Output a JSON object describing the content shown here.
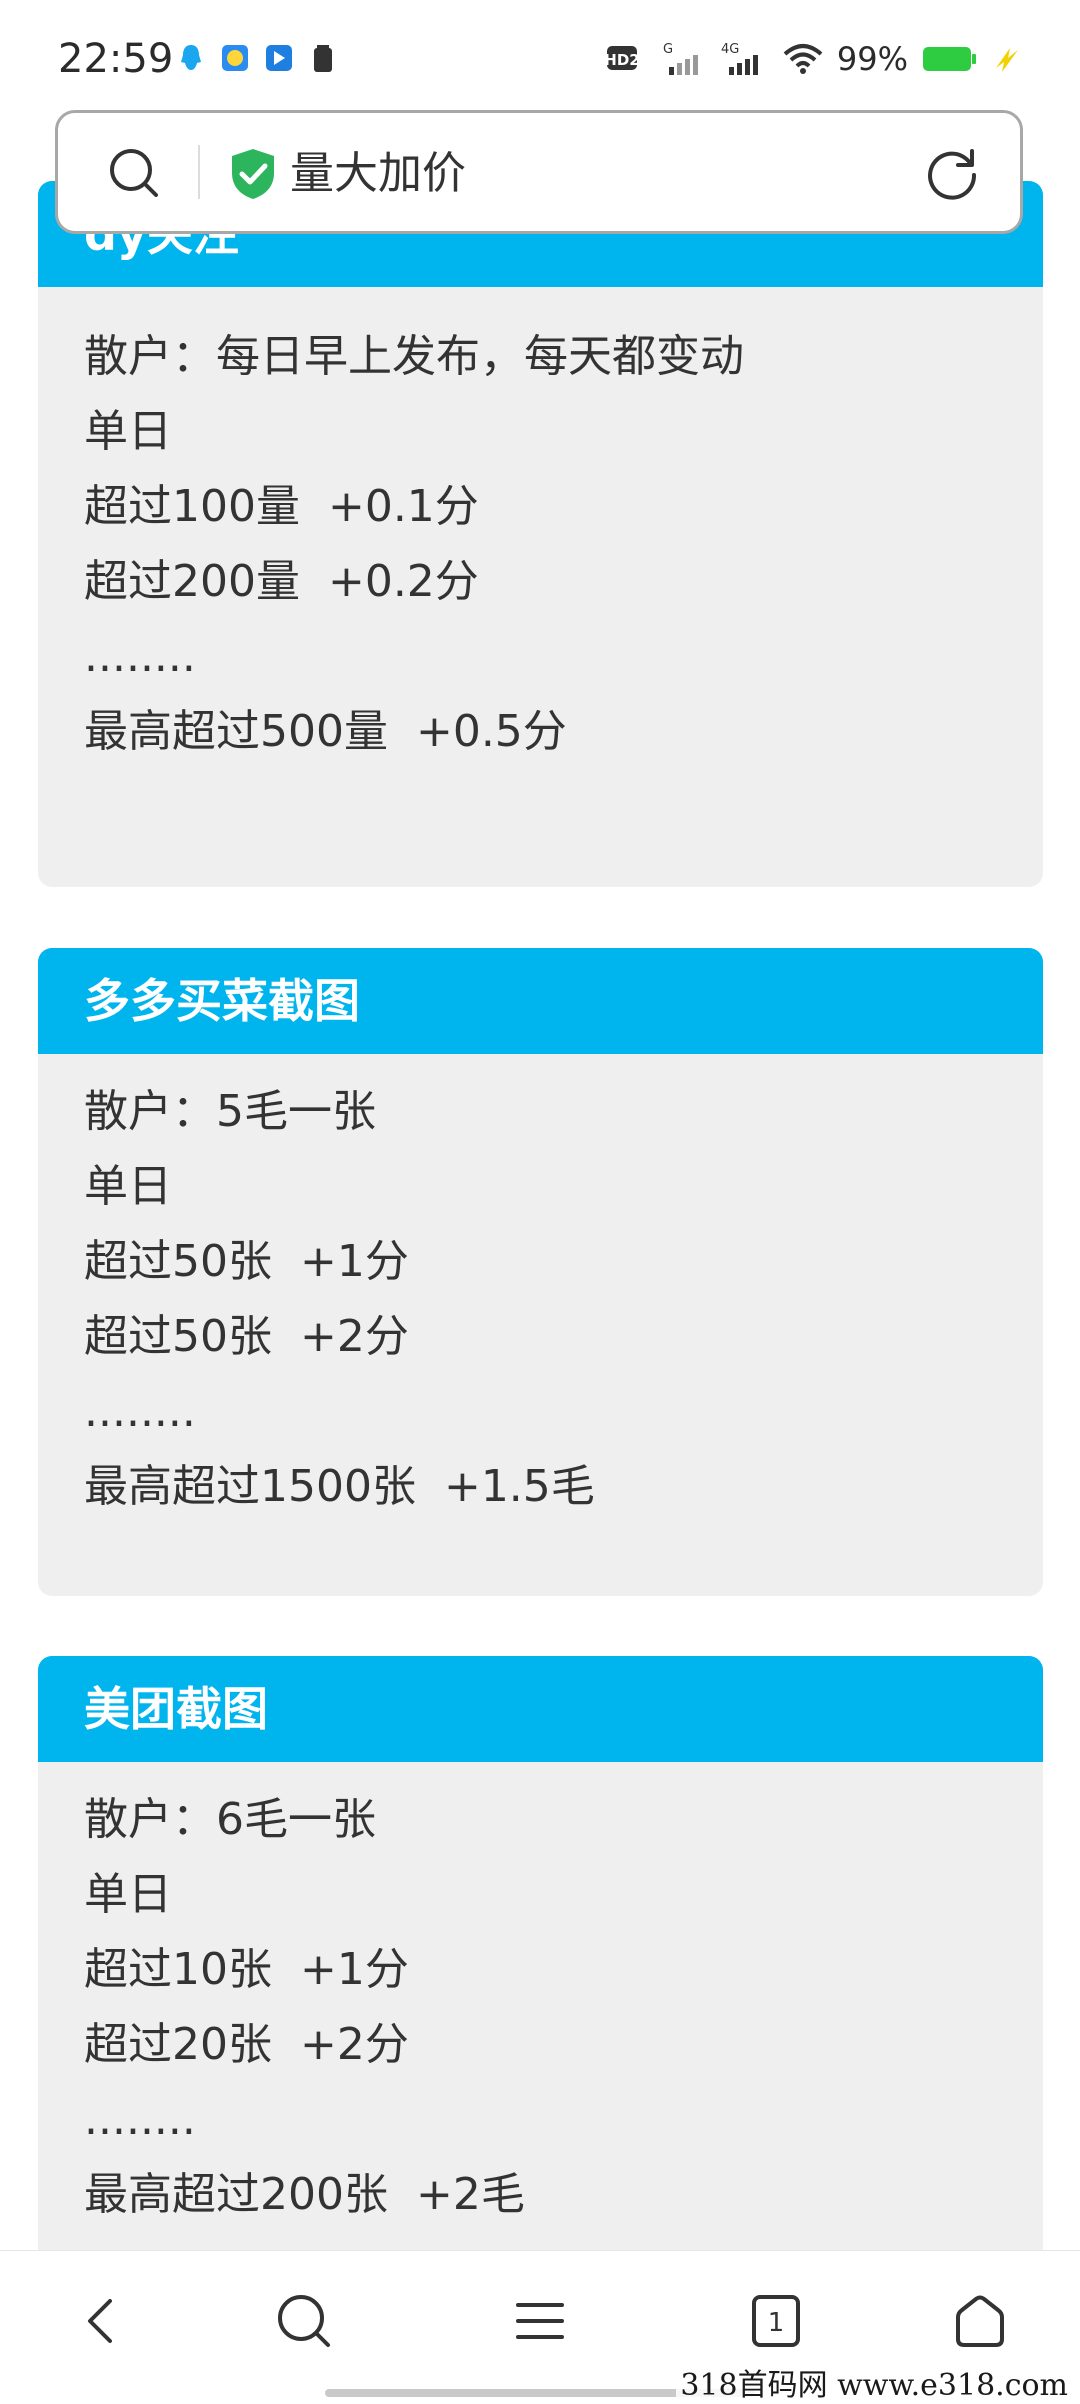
{
  "status_bar": {
    "time": "22:59",
    "battery_percent": "99%",
    "network_labels": [
      "HD2",
      "G",
      "4G"
    ],
    "icons": [
      "qq-icon",
      "app-icon",
      "direct-icon",
      "battery-small-icon",
      "hd-icon",
      "signal-g-icon",
      "signal-4g-icon",
      "wifi-icon",
      "battery-icon",
      "charging-icon"
    ]
  },
  "search_bar": {
    "query": "量大加价"
  },
  "cards": [
    {
      "title": "dy关注",
      "lines": [
        "散户：每日早上发布，每天都变动",
        "单日",
        "超过100量  +0.1分",
        "超过200量  +0.2分",
        "........",
        "最高超过500量  +0.5分"
      ]
    },
    {
      "title": "多多买菜截图",
      "lines": [
        "散户：5毛一张",
        "单日",
        "超过50张  +1分",
        "超过50张  +2分",
        "........",
        "最高超过1500张  +1.5毛"
      ]
    },
    {
      "title": "美团截图",
      "lines": [
        "散户：6毛一张",
        "单日",
        "超过10张  +1分",
        "超过20张  +2分",
        "........",
        "最高超过200张  +2毛"
      ]
    }
  ],
  "bottom_nav": {
    "tab_count": "1"
  },
  "watermark": "318首码网  www.e318.com",
  "colors": {
    "header_blue": "#00b4ee",
    "card_bg": "#efefef",
    "shield_green": "#2db55d",
    "battery_green": "#2ecc40",
    "charging_yellow": "#f2d100"
  }
}
